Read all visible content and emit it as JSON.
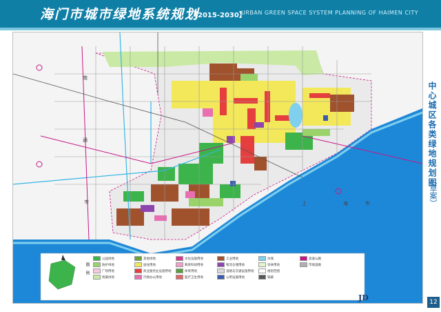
{
  "header": {
    "title_cn": "海门市城市绿地系统规划",
    "years": "【2015-2030】",
    "title_en": "URBAN GREEN SPACE SYSTEM PLANNING OF HAIMEN CITY"
  },
  "side_title": "中心城区各类绿地规划图",
  "side_draft": "（草案）",
  "page_number": "12",
  "legend_heading": "图例",
  "map_labels": {
    "upper": "上",
    "sea": "海",
    "city": "市",
    "south": "南",
    "tong": "通",
    "city2": "市"
  },
  "legend_items": [
    {
      "label": "公园绿地",
      "color": "#3cb44b"
    },
    {
      "label": "防护绿地",
      "color": "#9bd36b"
    },
    {
      "label": "广场用地",
      "color": "#f7c9de"
    },
    {
      "label": "附属绿地",
      "color": "#c9e9a4"
    },
    {
      "label": "其他绿地",
      "color": "#6fa23d"
    },
    {
      "label": "居住用地",
      "color": "#f3e85a"
    },
    {
      "label": "商业服务业设施用地",
      "color": "#e53e3e"
    },
    {
      "label": "行政办公用地",
      "color": "#e86fb0"
    },
    {
      "label": "文化设施用地",
      "color": "#d13d8a"
    },
    {
      "label": "教育科研用地",
      "color": "#f0a0c8"
    },
    {
      "label": "体育用地",
      "color": "#5a9d3b"
    },
    {
      "label": "医疗卫生用地",
      "color": "#e06666"
    },
    {
      "label": "工业用地",
      "color": "#a0522d"
    },
    {
      "label": "物流仓储用地",
      "color": "#8e44ad"
    },
    {
      "label": "道路与交通设施用地",
      "color": "#d9d9d9"
    },
    {
      "label": "公用设施用地",
      "color": "#3b5cad"
    },
    {
      "label": "水域",
      "color": "#7fd0ee"
    },
    {
      "label": "农林用地",
      "color": "#e6f5d0"
    },
    {
      "label": "规划范围",
      "color": "#ffffff"
    },
    {
      "label": "铁路",
      "color": "#555555"
    },
    {
      "label": "高速公路",
      "color": "#c71585"
    },
    {
      "label": "市域道路",
      "color": "#b0b0b0"
    }
  ]
}
